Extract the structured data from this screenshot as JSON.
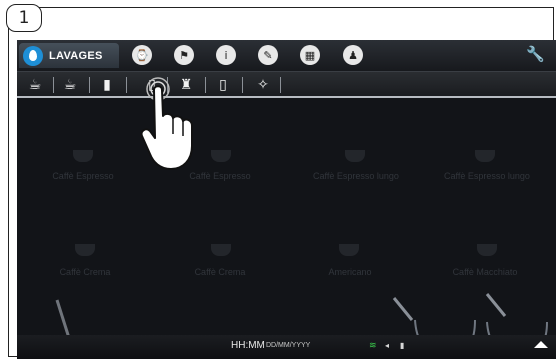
{
  "step": {
    "number": "1"
  },
  "topbar": {
    "active_tab": {
      "label": "LAVAGES",
      "icon": "water-drop-icon"
    },
    "icons": [
      "clock-icon",
      "flag-icon",
      "info-icon",
      "pencil-icon",
      "calendar-icon",
      "user-icon"
    ],
    "right_icon": "wrench-icon"
  },
  "subbar": {
    "icons": [
      "cup-rinse-icon",
      "cup-icon",
      "milk-carton-icon",
      "glass-icon",
      "milk-jug-icon",
      "water-glass-icon",
      "cleaning-icon"
    ]
  },
  "products": [
    {
      "label": "Caffè Espresso"
    },
    {
      "label": "Caffè Espresso"
    },
    {
      "label": "Caffè Espresso lungo"
    },
    {
      "label": "Caffè Espresso lungo"
    },
    {
      "label": "Caffè Crema"
    },
    {
      "label": "Caffè Crema"
    },
    {
      "label": "Americano"
    },
    {
      "label": "Caffè Macchiato"
    }
  ],
  "status": {
    "time": "HH:MM",
    "date": "DD/MM/YYYY"
  },
  "colors": {
    "accent_blue": "#1e8fd6",
    "wifi_green": "#3ccf4e",
    "background": "#121418"
  }
}
